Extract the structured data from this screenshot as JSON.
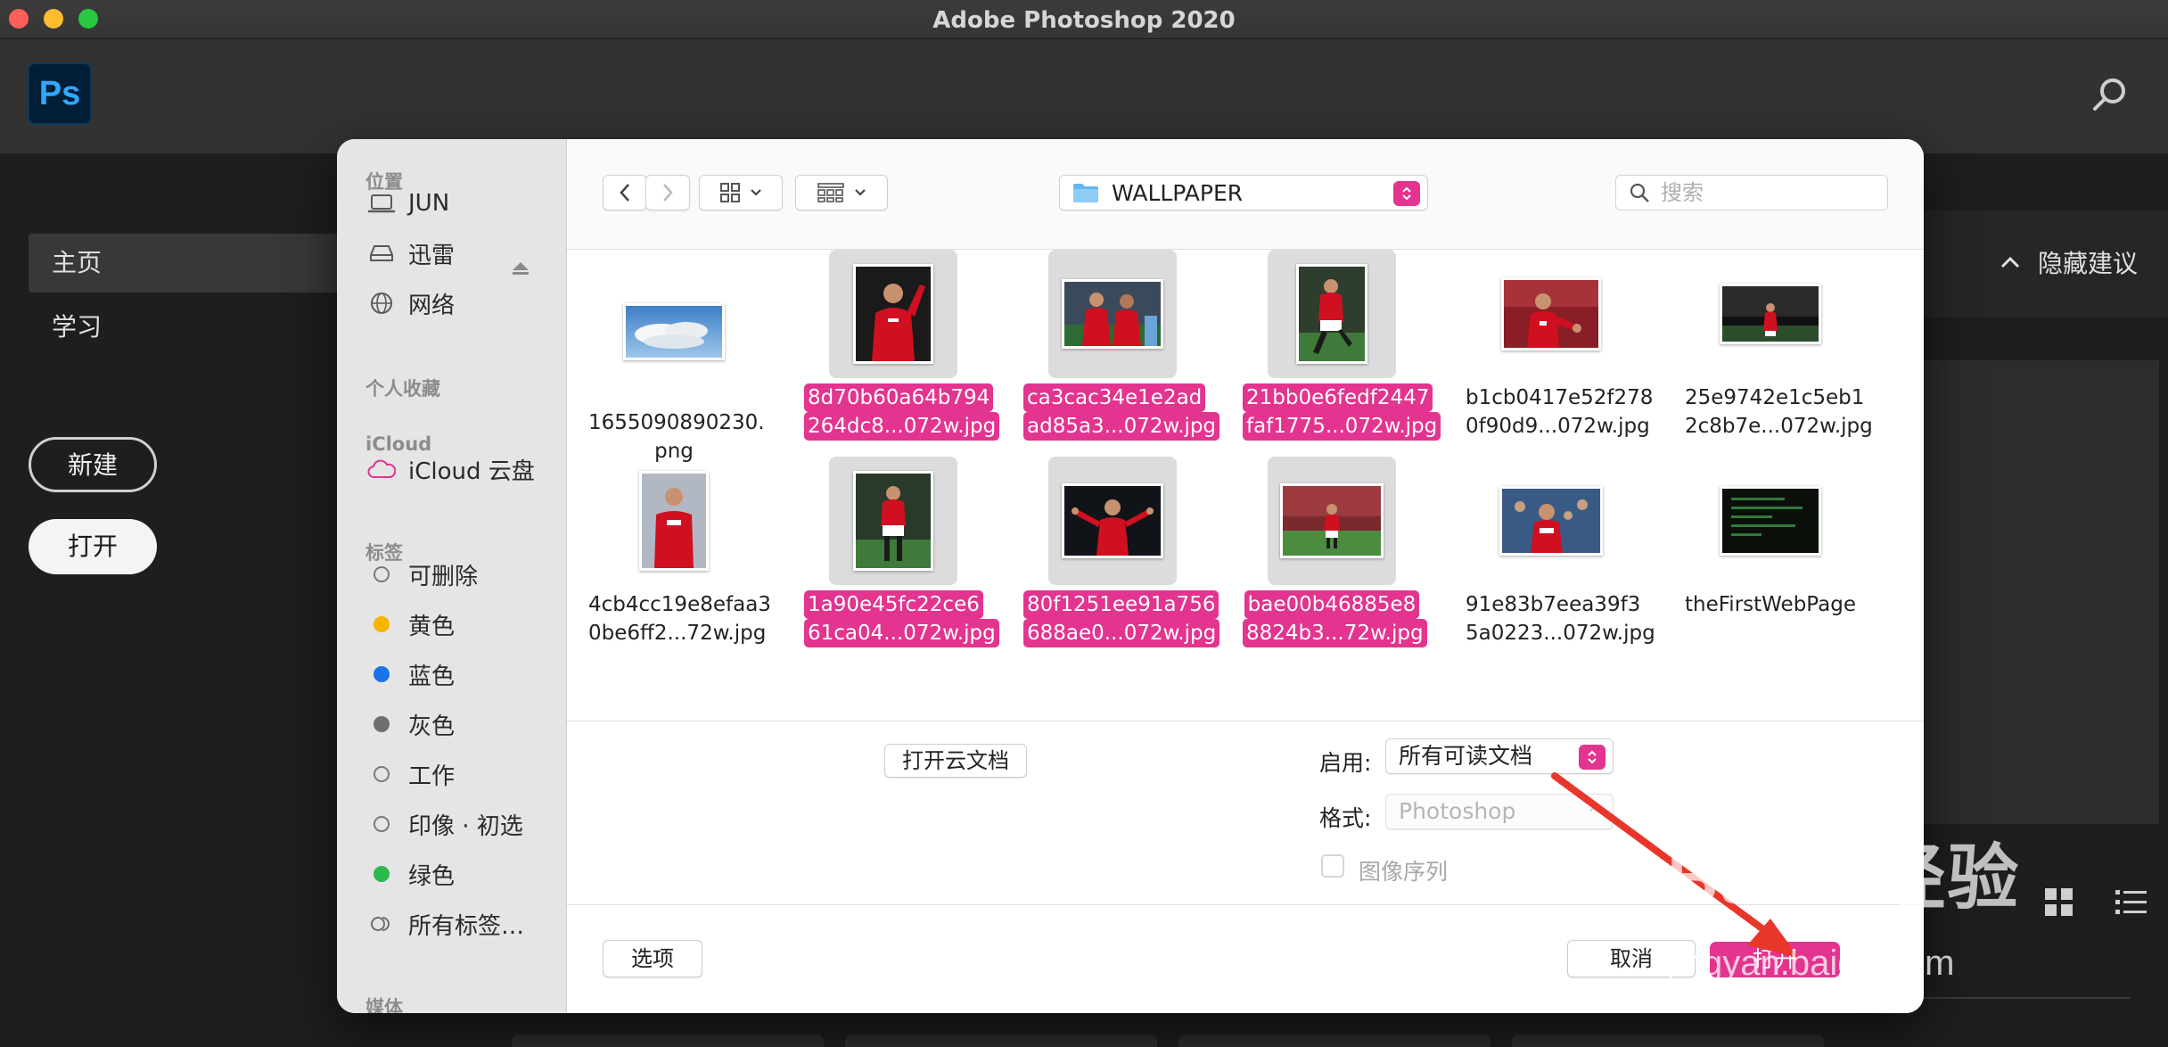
{
  "window": {
    "title": "Adobe Photoshop 2020"
  },
  "app": {
    "logo_text": "Ps"
  },
  "nav": {
    "items": [
      {
        "label": "主页"
      },
      {
        "label": "学习"
      }
    ],
    "new_label": "新建",
    "open_label": "打开"
  },
  "background": {
    "hide_suggestions": "隐藏建议"
  },
  "dialog": {
    "sidebar": {
      "locations_title": "位置",
      "locations": [
        {
          "label": "JUN"
        },
        {
          "label": "迅雷"
        },
        {
          "label": "网络"
        }
      ],
      "favorites_title": "个人收藏",
      "icloud_title": "iCloud",
      "icloud_drive": "iCloud 云盘",
      "tags_title": "标签",
      "tags": [
        {
          "label": "可删除",
          "color": ""
        },
        {
          "label": "黄色",
          "color": "#f5b400"
        },
        {
          "label": "蓝色",
          "color": "#1a73e8"
        },
        {
          "label": "灰色",
          "color": "#6e6e6e"
        },
        {
          "label": "工作",
          "color": ""
        },
        {
          "label": "印像 · 初选",
          "color": ""
        },
        {
          "label": "绿色",
          "color": "#2db84d"
        },
        {
          "label": "所有标签…",
          "color": ""
        }
      ],
      "media_title": "媒体"
    },
    "toolbar": {
      "folder": "WALLPAPER",
      "search_placeholder": "搜索"
    },
    "files": [
      {
        "line1": "1655090890230.",
        "line2": "png",
        "selected": false,
        "thumb": "clouds"
      },
      {
        "line1": "8d70b60a64b794",
        "line2": "264dc8...072w.jpg",
        "selected": true,
        "thumb": "player-portrait"
      },
      {
        "line1": "ca3cac34e1e2ad",
        "line2": "ad85a3...072w.jpg",
        "selected": true,
        "thumb": "players-pair"
      },
      {
        "line1": "21bb0e6fedf2447",
        "line2": "faf1775...072w.jpg",
        "selected": true,
        "thumb": "player-kick"
      },
      {
        "line1": "b1cb0417e52f278",
        "line2": "0f90d9...072w.jpg",
        "selected": false,
        "thumb": "player-celebrate"
      },
      {
        "line1": "25e9742e1c5eb1",
        "line2": "2c8b7e...072w.jpg",
        "selected": false,
        "thumb": "player-stadium"
      },
      {
        "line1": "4cb4cc19e8efaa3",
        "line2": "0be6ff2...72w.jpg",
        "selected": false,
        "thumb": "player-portrait"
      },
      {
        "line1": "1a90e45fc22ce6",
        "line2": "61ca04...072w.jpg",
        "selected": true,
        "thumb": "player-kick"
      },
      {
        "line1": "80f1251ee91a756",
        "line2": "688ae0...072w.jpg",
        "selected": true,
        "thumb": "player-arms"
      },
      {
        "line1": "bae00b46885e8",
        "line2": "8824b3...72w.jpg",
        "selected": true,
        "thumb": "player-pitch"
      },
      {
        "line1": "91e83b7eea39f3",
        "line2": "5a0223...072w.jpg",
        "selected": false,
        "thumb": "player-crowd"
      },
      {
        "line1": "theFirstWebPage",
        "line2": "",
        "selected": false,
        "thumb": "webpage"
      }
    ],
    "options": {
      "open_cloud_label": "打开云文档",
      "enable_label": "启用:",
      "enable_value": "所有可读文档",
      "format_label": "格式:",
      "format_value": "Photoshop",
      "image_sequence_label": "图像序列"
    },
    "footer": {
      "options_label": "选项",
      "cancel_label": "取消",
      "open_label": "打开"
    }
  },
  "watermark": {
    "main": "Baidu经验",
    "sub": "jingyan.baidu.com"
  },
  "colors": {
    "accent": "#e3348f",
    "ps_blue": "#31a8ff",
    "annotation_red": "#e8362b"
  }
}
